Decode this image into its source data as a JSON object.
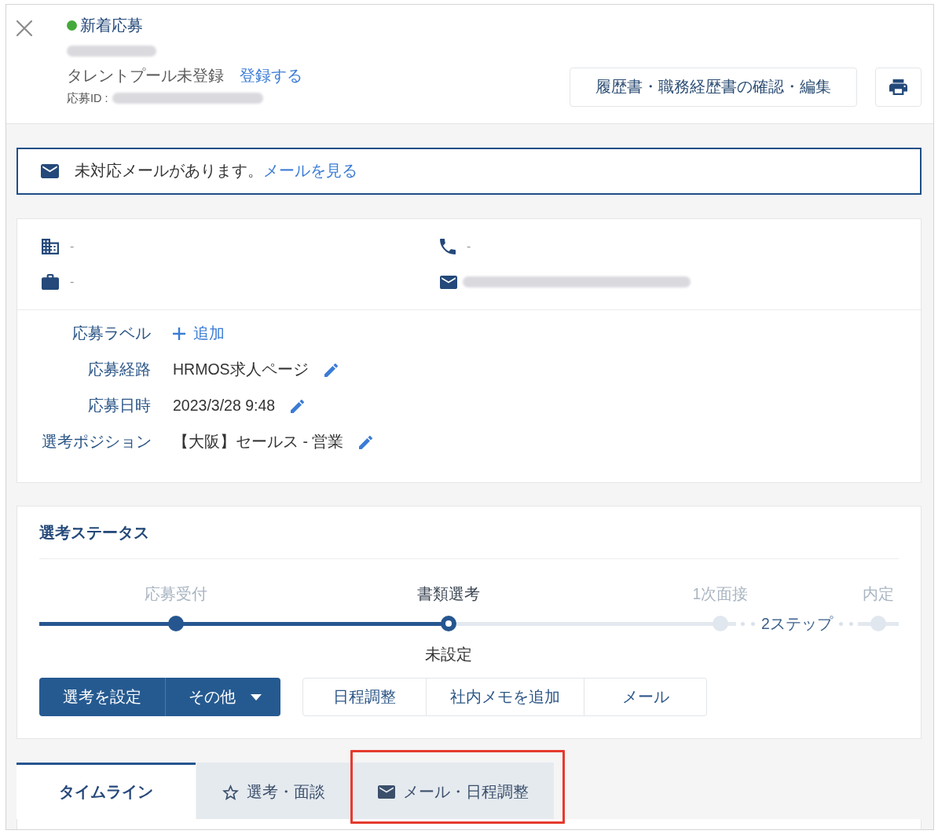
{
  "header": {
    "status": {
      "label": "新着応募",
      "color": "#44a93a"
    },
    "applicant_name": {
      "redacted": true
    },
    "talent_pool": {
      "text": "タレントプール未登録",
      "link": "登録する"
    },
    "application_id": {
      "label": "応募ID :",
      "redacted": true
    },
    "buttons": [
      {
        "kind": "text",
        "label": "履歴書・職務経歴書の確認・編集"
      },
      {
        "kind": "print"
      }
    ]
  },
  "notice": {
    "text": "未対応メールがあります。",
    "link": "メールを見る"
  },
  "contact": [
    {
      "kind": "company",
      "value": "-"
    },
    {
      "kind": "phone",
      "value": "-"
    },
    {
      "kind": "job",
      "value": "-"
    },
    {
      "kind": "email",
      "redacted": true
    }
  ],
  "details": [
    {
      "label": "応募ラベル",
      "kind": "add",
      "value": "追加"
    },
    {
      "label": "応募経路",
      "kind": "editable",
      "value": "HRMOS求人ページ"
    },
    {
      "label": "応募日時",
      "kind": "editable",
      "value": "2023/3/28 9:48"
    },
    {
      "label": "選考ポジション",
      "kind": "editable",
      "value": "【大阪】セールス - 営業"
    }
  ],
  "selection_status": {
    "title": "選考ステータス",
    "progress": {
      "level": 0.587
    },
    "steps": [
      {
        "kind": "step",
        "label": "応募受付",
        "completed": true,
        "selected": false
      },
      {
        "kind": "step",
        "label": "書類選考",
        "completed": false,
        "selected": true,
        "note": "未設定"
      },
      {
        "kind": "step",
        "label": "1次面接",
        "completed": false,
        "selected": false
      },
      {
        "kind": "collapsed",
        "label": "2ステップ"
      },
      {
        "kind": "step",
        "label": "内定",
        "completed": false,
        "selected": false
      }
    ],
    "primary_actions": [
      {
        "kind": "button",
        "label": "選考を設定"
      },
      {
        "kind": "dropdown",
        "label": "その他"
      }
    ],
    "secondary_actions": [
      {
        "label": "日程調整"
      },
      {
        "label": "社内メモを追加"
      },
      {
        "label": "メール"
      }
    ]
  },
  "tabs": [
    {
      "kind": "timeline",
      "label": "タイムライン",
      "selected": true,
      "highlighted": false
    },
    {
      "kind": "selection",
      "label": "選考・面談",
      "selected": false,
      "highlighted": false
    },
    {
      "kind": "mail",
      "label": "メール・日程調整",
      "selected": false,
      "highlighted": true
    }
  ]
}
